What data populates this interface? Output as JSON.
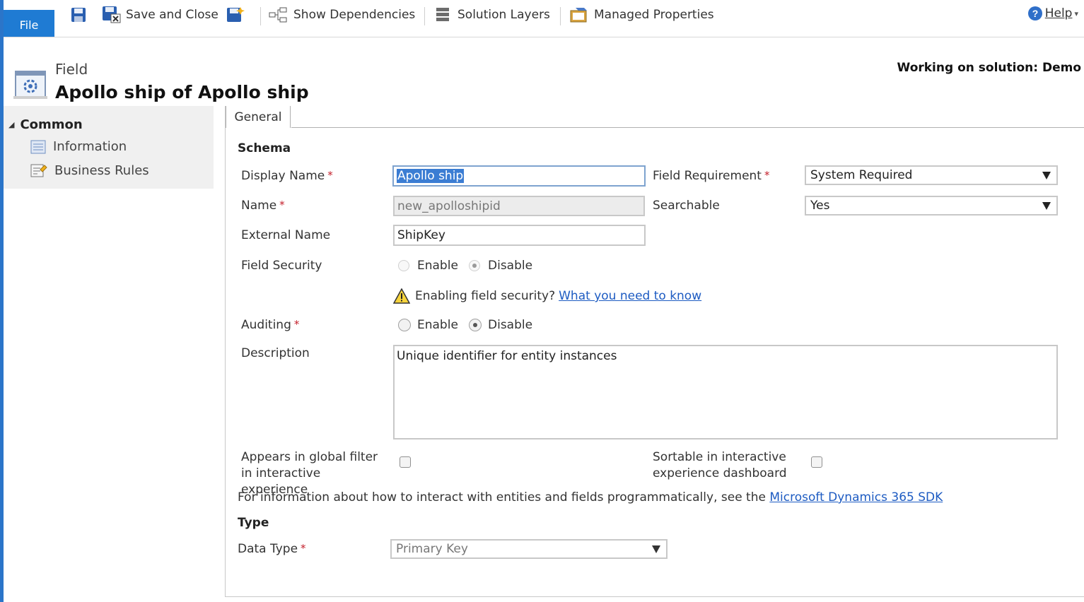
{
  "ribbon": {
    "file_label": "File",
    "save_and_close": "Save and Close",
    "show_dependencies": "Show Dependencies",
    "solution_layers": "Solution Layers",
    "managed_properties": "Managed Properties",
    "help": "Help"
  },
  "header": {
    "kind": "Field",
    "title": "Apollo ship of Apollo ship",
    "solution": "Working on solution: Demo"
  },
  "sidebar": {
    "group": "Common",
    "items": [
      {
        "label": "Information",
        "icon": "form-icon"
      },
      {
        "label": "Business Rules",
        "icon": "business-rules-icon"
      }
    ]
  },
  "tabs": [
    {
      "label": "General"
    }
  ],
  "schema": {
    "heading": "Schema",
    "display_name_label": "Display Name",
    "display_name_value": "Apollo ship",
    "name_label": "Name",
    "name_value": "new_apolloshipid",
    "external_name_label": "External Name",
    "external_name_value": "ShipKey",
    "field_security_label": "Field Security",
    "field_security_selected": "Disable",
    "enable_label": "Enable",
    "disable_label": "Disable",
    "security_warning": "Enabling field security?",
    "security_link": "What you need to know",
    "auditing_label": "Auditing",
    "auditing_selected": "Disable",
    "description_label": "Description",
    "description_value": "Unique identifier for entity instances",
    "field_requirement_label": "Field Requirement",
    "field_requirement_value": "System Required",
    "searchable_label": "Searchable",
    "searchable_value": "Yes",
    "global_filter_label": "Appears in global filter in interactive experience",
    "global_filter_checked": false,
    "sortable_label": "Sortable in interactive experience dashboard",
    "sortable_checked": false,
    "sdk_text": "For information about how to interact with entities and fields programmatically, see the",
    "sdk_link": "Microsoft Dynamics 365 SDK"
  },
  "type": {
    "heading": "Type",
    "data_type_label": "Data Type",
    "data_type_value": "Primary Key"
  },
  "colors": {
    "accent": "#1f7bd3",
    "required": "#c4202c",
    "link": "#1d5bc2"
  }
}
